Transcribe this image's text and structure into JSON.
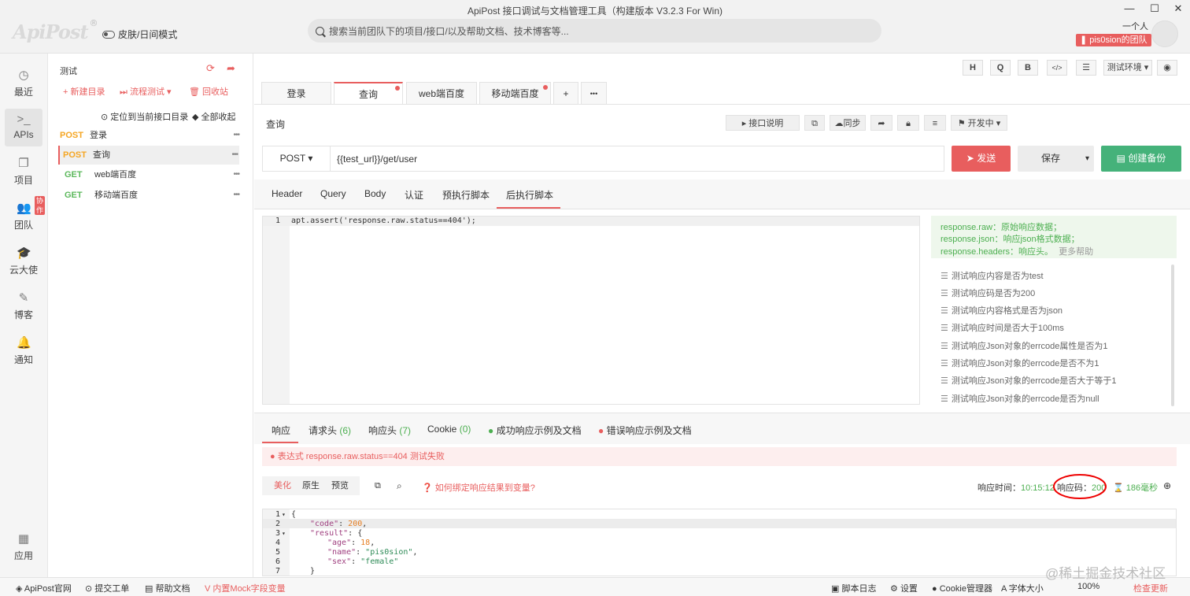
{
  "window": {
    "title": "ApiPost 接口调试与文档管理工具（构建版本 V3.2.3 For Win)",
    "logo": "ApiPost",
    "logo_mark": "®",
    "skin_mode": "皮肤/日间模式",
    "search_placeholder": "搜索当前团队下的项目/接口/以及帮助文档、技术博客等...",
    "user_name": "一个人",
    "team_badge": "pis0sion的团队"
  },
  "nav": {
    "recent": "最近",
    "apis": "APIs",
    "project": "项目",
    "team": "团队",
    "team_badge": "协作",
    "cloud": "云大使",
    "blog": "博客",
    "notify": "通知",
    "apps": "应用"
  },
  "tree": {
    "project": "测试",
    "new_dir": "+ 新建目录",
    "flow_test": "流程测试",
    "recycle": "回收站",
    "locate": "定位到当前接口目录",
    "collapse": "全部收起",
    "items": [
      {
        "method": "POST",
        "name": "登录"
      },
      {
        "method": "POST",
        "name": "查询"
      },
      {
        "method": "GET",
        "name": "web端百度"
      },
      {
        "method": "GET",
        "name": "移动端百度"
      }
    ]
  },
  "toolbar": {
    "h": "H",
    "q": "Q",
    "b": "B",
    "code": "</>",
    "env": "测试环境"
  },
  "tabs": [
    "登录",
    "查询",
    "web端百度",
    "移动端百度"
  ],
  "tab_add": "+",
  "tab_more": "•••",
  "api": {
    "name": "查询",
    "doc_btn": "接口说明",
    "sync_btn": "同步",
    "status": "开发中",
    "method": "POST",
    "url": "{{test_url}}/get/user",
    "send": "发送",
    "save": "保存",
    "backup": "创建备份"
  },
  "req_tabs": [
    "Header",
    "Query",
    "Body",
    "认证",
    "预执行脚本",
    "后执行脚本"
  ],
  "script": {
    "line": "1",
    "code": "apt.assert('response.raw.status==404');"
  },
  "help": {
    "line1": "response.raw：原始响应数据；",
    "line2": "response.json：响应json格式数据；",
    "line3": "response.headers：响应头。",
    "more": "更多帮助",
    "snippets": [
      "测试响应内容是否为test",
      "测试响应码是否为200",
      "测试响应内容格式是否为json",
      "测试响应时间是否大于100ms",
      "测试响应Json对象的errcode属性是否为1",
      "测试响应Json对象的errcode是否不为1",
      "测试响应Json对象的errcode是否大于等于1",
      "测试响应Json对象的errcode是否为null"
    ]
  },
  "resp_tabs": {
    "resp": "响应",
    "req_headers": "请求头",
    "req_headers_count": "(6)",
    "resp_headers": "响应头",
    "resp_headers_count": "(7)",
    "cookie": "Cookie",
    "cookie_count": "(0)",
    "success": "成功响应示例及文档",
    "error": "错误响应示例及文档"
  },
  "assert_error": "表达式 response.raw.status==404 测试失败",
  "view": {
    "pretty": "美化",
    "raw": "原生",
    "preview": "预览",
    "bind_help": "如何绑定响应结果到变量?",
    "time_label": "响应时间：",
    "time": "10:15:12",
    "code_label": "响应码：",
    "code": "200",
    "duration": "186毫秒"
  },
  "json_lines": [
    {
      "n": "1",
      "t": "{"
    },
    {
      "n": "2",
      "k": "\"code\"",
      "v": "200",
      "vt": "num"
    },
    {
      "n": "3",
      "k": "\"result\"",
      "v": "{",
      "vt": "p"
    },
    {
      "n": "4",
      "k": "\"age\"",
      "v": "18",
      "vt": "num"
    },
    {
      "n": "5",
      "k": "\"name\"",
      "v": "\"pis0sion\"",
      "vt": "str"
    },
    {
      "n": "6",
      "k": "\"sex\"",
      "v": "\"female\"",
      "vt": "str"
    },
    {
      "n": "7",
      "t": "}"
    }
  ],
  "footer": {
    "site": "ApiPost官网",
    "ticket": "提交工单",
    "docs": "帮助文档",
    "mock": "内置Mock字段变量",
    "log": "脚本日志",
    "settings": "设置",
    "cookie_mgr": "Cookie管理器",
    "font": "字体大小",
    "zoom": "100%",
    "update": "检查更新",
    "watermark": "@稀土掘金技术社区"
  }
}
